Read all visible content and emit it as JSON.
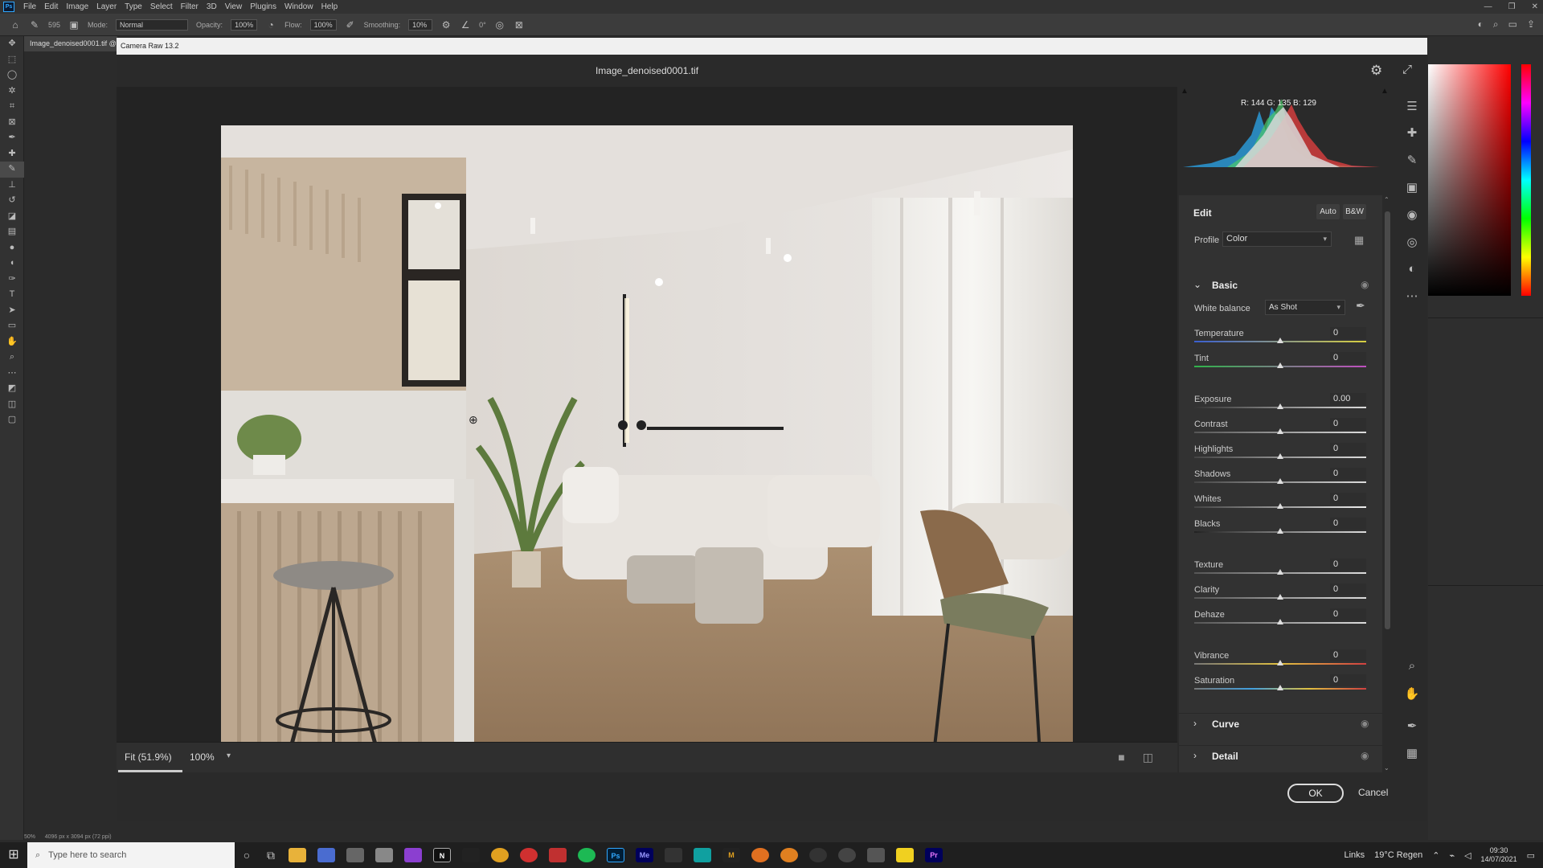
{
  "menubar": {
    "items": [
      "File",
      "Edit",
      "Image",
      "Layer",
      "Type",
      "Select",
      "Filter",
      "3D",
      "View",
      "Plugins",
      "Window",
      "Help"
    ]
  },
  "optbar": {
    "brush_size": "595",
    "mode_label": "Mode:",
    "mode_value": "Normal",
    "opacity_label": "Opacity:",
    "opacity_value": "100%",
    "flow_label": "Flow:",
    "flow_value": "100%",
    "smoothing_label": "Smoothing:",
    "smoothing_value": "10%",
    "angle_value": "0°"
  },
  "document": {
    "tab_label": "Image_denoised0001.tif @"
  },
  "camera_raw": {
    "window_title": "Camera Raw 13.2",
    "file_title": "Image_denoised0001.tif",
    "histogram_rgb": "R: 144   G: 135   B: 129",
    "edit_title": "Edit",
    "auto_label": "Auto",
    "bw_label": "B&W",
    "profile_label": "Profile",
    "profile_value": "Color",
    "basic_label": "Basic",
    "wb_label": "White balance",
    "wb_value": "As Shot",
    "sliders": [
      {
        "label": "Temperature",
        "value": "0"
      },
      {
        "label": "Tint",
        "value": "0"
      },
      {
        "label": "Exposure",
        "value": "0.00"
      },
      {
        "label": "Contrast",
        "value": "0"
      },
      {
        "label": "Highlights",
        "value": "0"
      },
      {
        "label": "Shadows",
        "value": "0"
      },
      {
        "label": "Whites",
        "value": "0"
      },
      {
        "label": "Blacks",
        "value": "0"
      },
      {
        "label": "Texture",
        "value": "0"
      },
      {
        "label": "Clarity",
        "value": "0"
      },
      {
        "label": "Dehaze",
        "value": "0"
      },
      {
        "label": "Vibrance",
        "value": "0"
      },
      {
        "label": "Saturation",
        "value": "0"
      }
    ],
    "curve_label": "Curve",
    "detail_label": "Detail",
    "fit_label": "Fit (51.9%)",
    "zoom_label": "100%",
    "ok_label": "OK",
    "cancel_label": "Cancel"
  },
  "status": {
    "zoom": "50%",
    "doc_info": "4096 px x 3094 px (72 ppi)"
  },
  "taskbar": {
    "search_placeholder": "Type here to search",
    "links_label": "Links",
    "weather": "19°C  Regen",
    "time": "09:30",
    "date": "14/07/2021"
  },
  "colors": {
    "accent": "#31a8ff",
    "panel_bg": "#323232",
    "dialog_bg": "#2a2a2a"
  }
}
